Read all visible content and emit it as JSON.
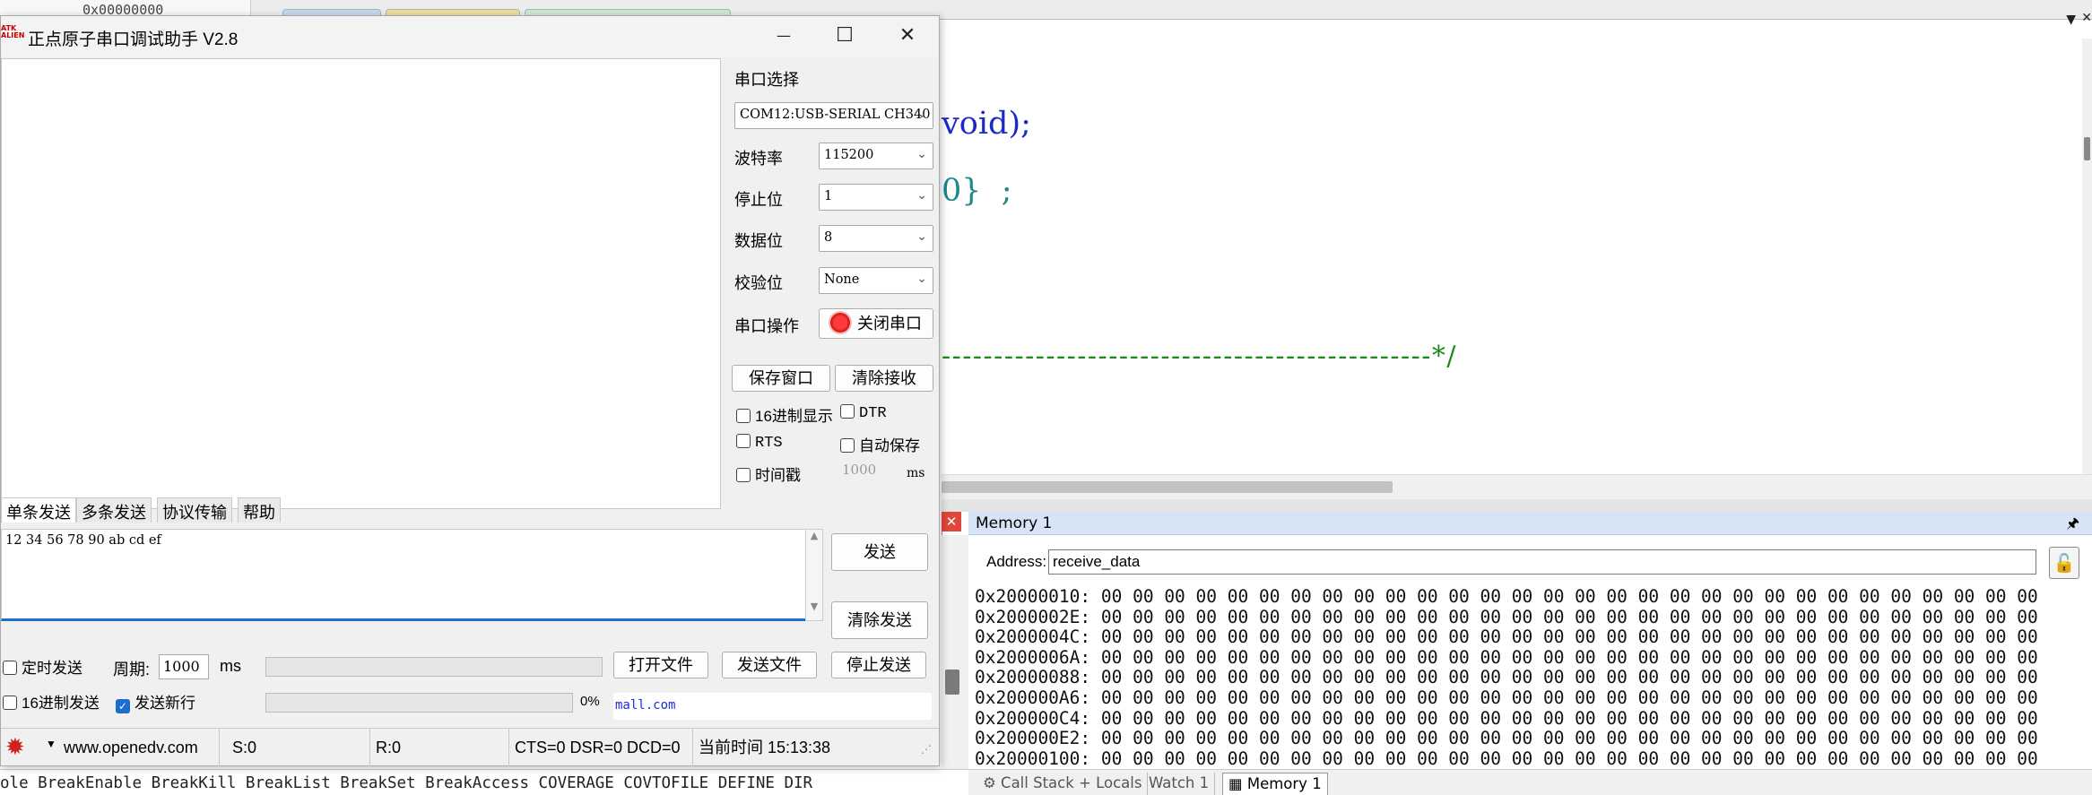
{
  "ide": {
    "topleft_value": "0x00000000",
    "code_lines": [
      {
        "text": "void);",
        "color": "#1d28c8"
      },
      {
        "text": "0}  ;",
        "color": "#1a8a8a"
      },
      {
        "text": "-----------------------------------------------*/",
        "color": "#1a8a1a"
      }
    ],
    "memory": {
      "title": "Memory 1",
      "address_label": "Address:",
      "address_value": "receive_data",
      "rows": [
        "0x20000010: 00 00 00 00 00 00 00 00 00 00 00 00 00 00 00 00 00 00 00 00 00 00 00 00 00 00 00 00 00 00",
        "0x2000002E: 00 00 00 00 00 00 00 00 00 00 00 00 00 00 00 00 00 00 00 00 00 00 00 00 00 00 00 00 00 00",
        "0x2000004C: 00 00 00 00 00 00 00 00 00 00 00 00 00 00 00 00 00 00 00 00 00 00 00 00 00 00 00 00 00 00",
        "0x2000006A: 00 00 00 00 00 00 00 00 00 00 00 00 00 00 00 00 00 00 00 00 00 00 00 00 00 00 00 00 00 00",
        "0x20000088: 00 00 00 00 00 00 00 00 00 00 00 00 00 00 00 00 00 00 00 00 00 00 00 00 00 00 00 00 00 00",
        "0x200000A6: 00 00 00 00 00 00 00 00 00 00 00 00 00 00 00 00 00 00 00 00 00 00 00 00 00 00 00 00 00 00",
        "0x200000C4: 00 00 00 00 00 00 00 00 00 00 00 00 00 00 00 00 00 00 00 00 00 00 00 00 00 00 00 00 00 00",
        "0x200000E2: 00 00 00 00 00 00 00 00 00 00 00 00 00 00 00 00 00 00 00 00 00 00 00 00 00 00 00 00 00 00",
        "0x20000100: 00 00 00 00 00 00 00 00 00 00 00 00 00 00 00 00 00 00 00 00 00 00 00 00 00 00 00 00 00 00"
      ]
    },
    "command_line": "ole BreakEnable BreakKill BreakList BreakSet BreakAccess COVERAGE COVTOFILE DEFINE DIR",
    "bottom_tabs": [
      "Call Stack + Locals",
      "Watch 1",
      "Memory 1"
    ]
  },
  "dialog": {
    "title": "正点原子串口调试助手 V2.8",
    "logo_text": "ATK",
    "window_controls": {
      "minimize": "—",
      "maximize": "☐",
      "close": "✕"
    },
    "port_section_label": "串口选择",
    "port_value": "COM12:USB-SERIAL CH340",
    "baud_label": "波特率",
    "baud_value": "115200",
    "stopbits_label": "停止位",
    "stopbits_value": "1",
    "databits_label": "数据位",
    "databits_value": "8",
    "parity_label": "校验位",
    "parity_value": "None",
    "port_op_label": "串口操作",
    "close_port_button": "关闭串口",
    "save_window_button": "保存窗口",
    "clear_recv_button": "清除接收",
    "hex_display": "16进制显示",
    "dtr": "DTR",
    "rts": "RTS",
    "auto_save": "自动保存",
    "timestamp": "时间戳",
    "timestamp_value": "1000",
    "timestamp_unit": "ms",
    "send_tabs": [
      "单条发送",
      "多条发送",
      "协议传输",
      "帮助"
    ],
    "send_text": "12 34 56 78 90 ab cd ef",
    "send_button": "发送",
    "clear_send_button": "清除发送",
    "timed_send": "定时发送",
    "period_label": "周期:",
    "period_value": "1000",
    "period_unit": "ms",
    "open_file_button": "打开文件",
    "send_file_button": "发送文件",
    "stop_send_button": "停止发送",
    "hex_send": "16进制发送",
    "send_newline": "发送新行",
    "progress_percent": "0%",
    "link_text": "mall.com",
    "status": {
      "website": "www.openedv.com",
      "sent": "S:0",
      "received": "R:0",
      "lines": "CTS=0 DSR=0 DCD=0",
      "time": "当前时间 15:13:38"
    }
  }
}
